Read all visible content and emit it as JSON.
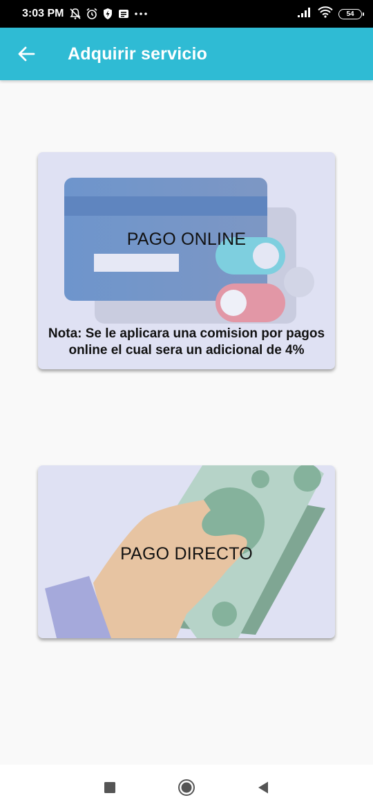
{
  "status_bar": {
    "time": "3:03 PM",
    "battery": "54",
    "icons": [
      "mute-icon",
      "alarm-icon",
      "shield-icon",
      "notification-icon",
      "more-dots-icon",
      "signal-icon",
      "wifi-icon",
      "battery-icon"
    ]
  },
  "app_bar": {
    "title": "Adquirir servicio",
    "background": "#2fbbd4"
  },
  "options": {
    "online": {
      "label": "PAGO ONLINE",
      "note": "Nota: Se le aplicara una comision por pagos online el cual sera un adicional de 4%"
    },
    "direct": {
      "label": "PAGO DIRECTO"
    }
  },
  "nav_bar": {
    "icons": [
      "recents-square-icon",
      "home-circle-icon",
      "back-triangle-icon"
    ]
  }
}
